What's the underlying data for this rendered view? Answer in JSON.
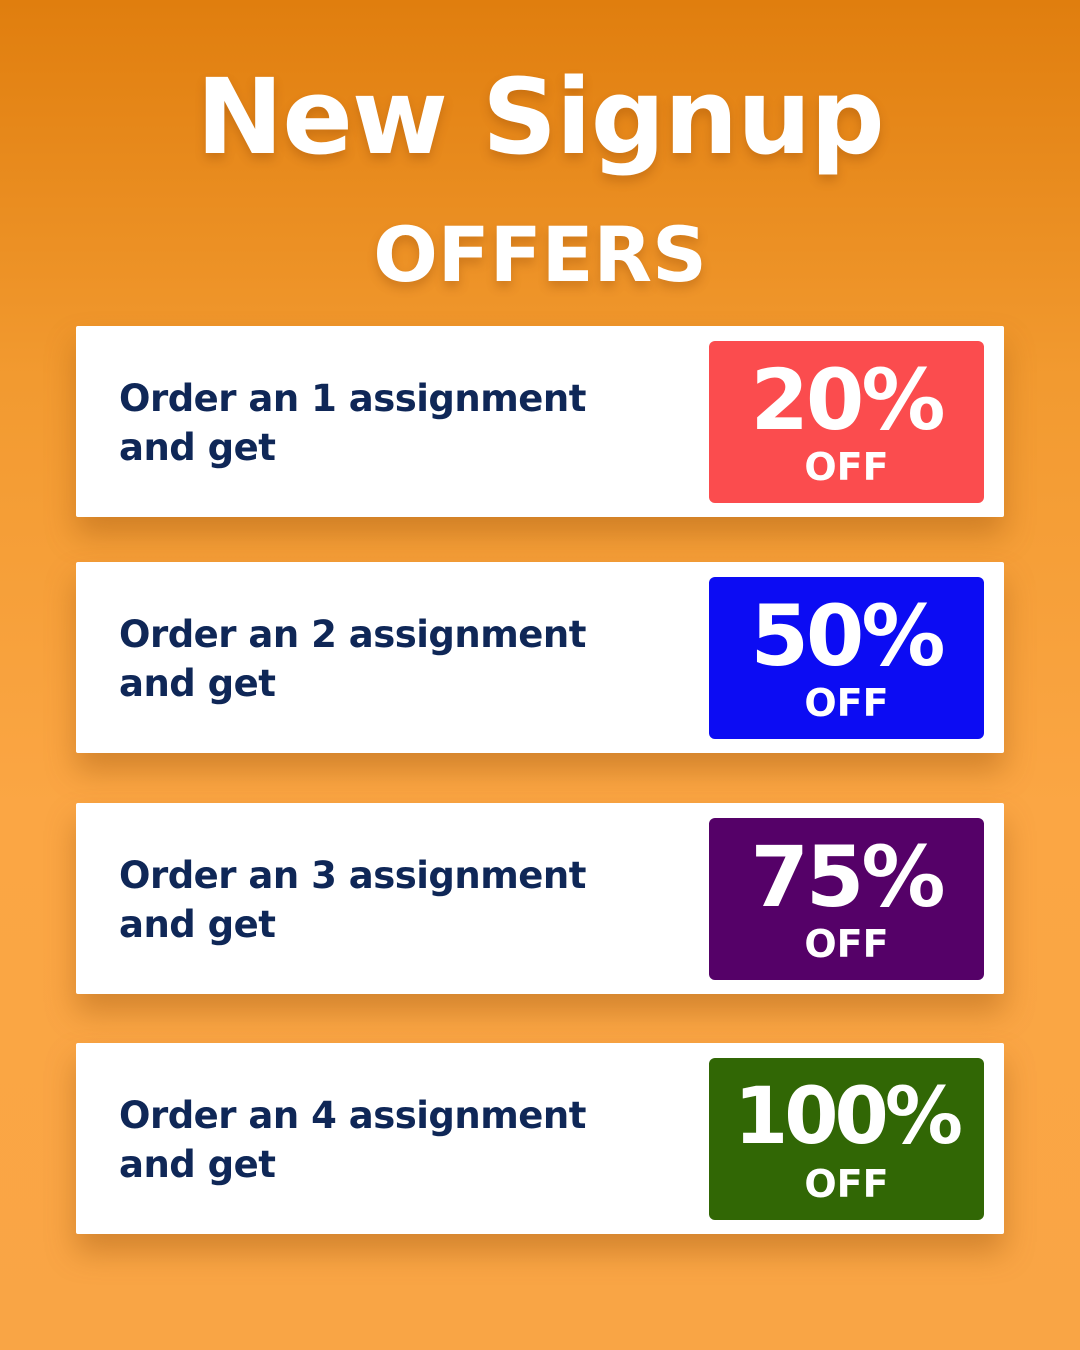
{
  "header": {
    "title": "New Signup",
    "subtitle": "OFFERS"
  },
  "offers": [
    {
      "line1": "Order an 1 assignment",
      "line2": "and get",
      "discount": "20%",
      "off_label": "OFF",
      "color": "#fb4c4e"
    },
    {
      "line1": "Order an 2 assignment",
      "line2": "and get",
      "discount": "50%",
      "off_label": "OFF",
      "color": "#0c0cf3"
    },
    {
      "line1": "Order an 3 assignment",
      "line2": "and get",
      "discount": "75%",
      "off_label": "OFF",
      "color": "#550168"
    },
    {
      "line1": "Order an 4 assignment",
      "line2": "and get",
      "discount": "100%",
      "off_label": "OFF",
      "color": "#316705"
    }
  ]
}
